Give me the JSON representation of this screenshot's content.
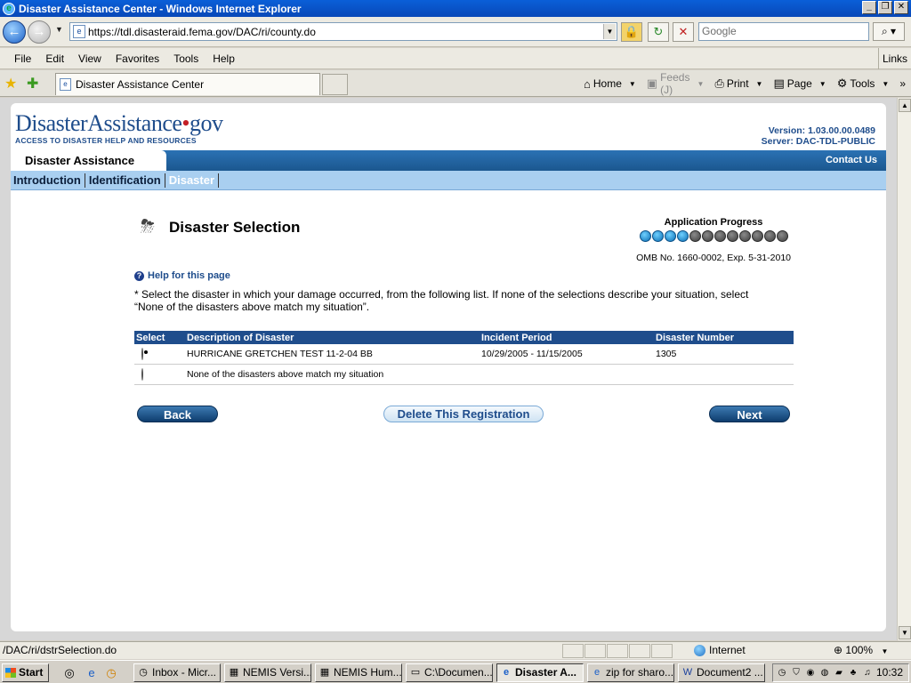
{
  "window": {
    "title": "Disaster Assistance Center - Windows Internet Explorer"
  },
  "browser": {
    "url": "https://tdl.disasteraid.fema.gov/DAC/ri/county.do",
    "search_placeholder": "Google",
    "menu": [
      "File",
      "Edit",
      "View",
      "Favorites",
      "Tools",
      "Help"
    ],
    "links_label": "Links",
    "tab_title": "Disaster Assistance Center",
    "commands": {
      "home": "Home",
      "feeds": "Feeds (J)",
      "print": "Print",
      "page": "Page",
      "tools": "Tools"
    },
    "status_text": "/DAC/ri/dstrSelection.do",
    "zone": "Internet",
    "zoom": "100%"
  },
  "site": {
    "logo_main": "DisasterAssistance",
    "logo_dot": "•",
    "logo_gov": "gov",
    "logo_tagline": "ACCESS TO DISASTER HELP AND RESOURCES",
    "version": "Version: 1.03.00.00.0489",
    "server": "Server: DAC-TDL-PUBLIC",
    "section_tab": "Disaster Assistance",
    "contact": "Contact Us",
    "subnav": [
      "Introduction",
      "Identification",
      "Disaster"
    ]
  },
  "content": {
    "heading": "Disaster Selection",
    "progress_title": "Application Progress",
    "progress_done": 4,
    "progress_total": 12,
    "omb": "OMB No. 1660-0002, Exp. 5-31-2010",
    "help_link": "Help for this page",
    "instructions": "* Select the disaster in which your damage occurred, from the following list. If none of the selections describe your situation, select “None of the disasters above match my situation”.",
    "table": {
      "headers": [
        "Select",
        "Description of Disaster",
        "Incident Period",
        "Disaster Number"
      ],
      "rows": [
        {
          "description": "HURRICANE GRETCHEN TEST 11-2-04 BB",
          "period": "10/29/2005 - 11/15/2005",
          "number": "1305",
          "selected": true
        },
        {
          "description": "None of the disasters above match my situation",
          "period": "",
          "number": "",
          "selected": false
        }
      ]
    },
    "buttons": {
      "back": "Back",
      "delete": "Delete This Registration",
      "next": "Next"
    }
  },
  "taskbar": {
    "start": "Start",
    "items": [
      "Inbox - Micr...",
      "NEMIS Versi...",
      "NEMIS Hum...",
      "C:\\Documen...",
      "Disaster A...",
      "zip for sharo...",
      "Document2 ..."
    ],
    "clock": "10:32"
  }
}
